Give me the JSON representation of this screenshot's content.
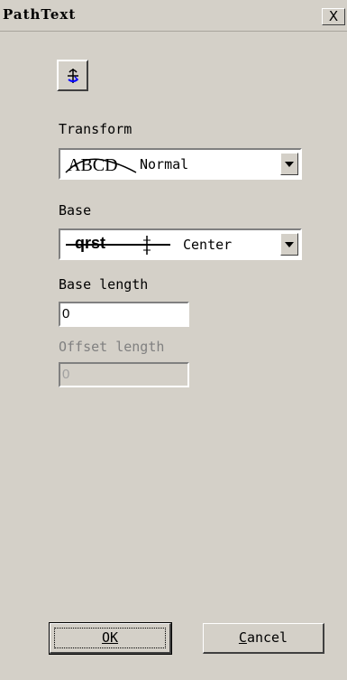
{
  "window": {
    "title": "PathText",
    "close_glyph": "X"
  },
  "toolbar": {
    "icon": "path-text-icon"
  },
  "transform": {
    "label": "Transform",
    "sample": "ABCD",
    "value": "Normal"
  },
  "base": {
    "label": "Base",
    "sample": "qrst",
    "value": "Center"
  },
  "base_length": {
    "label": "Base length",
    "value": "0"
  },
  "offset_length": {
    "label": "Offset length",
    "value": "0"
  },
  "buttons": {
    "ok_label": "OK",
    "cancel_mnemonic": "C",
    "cancel_rest": "ancel"
  }
}
